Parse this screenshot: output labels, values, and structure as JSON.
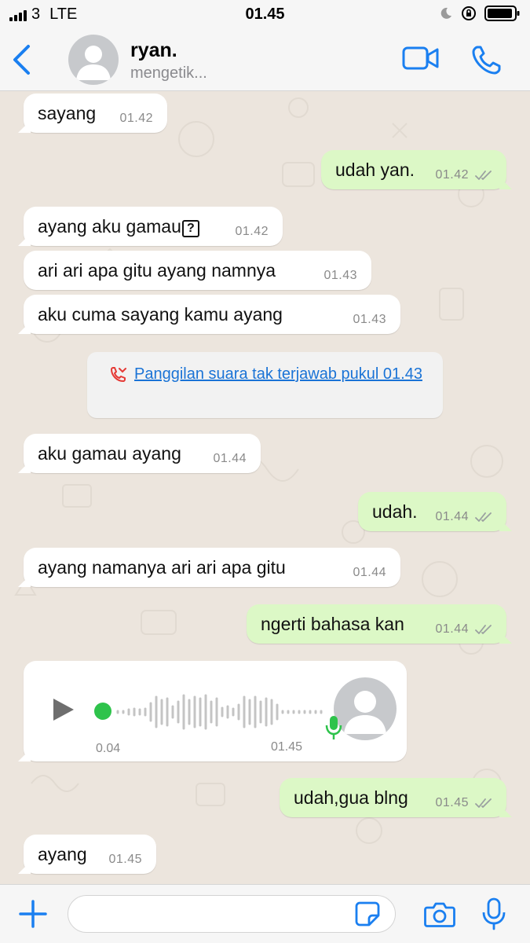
{
  "status_bar": {
    "carrier": "3",
    "network": "LTE",
    "time": "01.45"
  },
  "header": {
    "contact_name": "ryan.",
    "contact_status": "mengetik..."
  },
  "messages": [
    {
      "dir": "in",
      "text": "sayang",
      "time": "01.42"
    },
    {
      "dir": "out",
      "text": "udah yan.",
      "time": "01.42"
    },
    {
      "dir": "in",
      "text": "ayang aku gamau",
      "time": "01.42"
    },
    {
      "dir": "in",
      "text": "ari ari apa gitu ayang namnya",
      "time": "01.43"
    },
    {
      "dir": "in",
      "text": "aku cuma sayang kamu ayang",
      "time": "01.43"
    },
    {
      "dir": "in",
      "text": "aku gamau ayang",
      "time": "01.44"
    },
    {
      "dir": "out",
      "text": "udah.",
      "time": "01.44"
    },
    {
      "dir": "in",
      "text": "ayang namanya ari ari apa gitu",
      "time": "01.44"
    },
    {
      "dir": "out",
      "text": "ngerti bahasa kan",
      "time": "01.44"
    },
    {
      "dir": "out",
      "text": "udah,gua blng",
      "time": "01.45"
    },
    {
      "dir": "in",
      "text": "ayang",
      "time": "01.45"
    }
  ],
  "missed_call": {
    "text": "Panggilan suara tak terjawab pukul 01.43"
  },
  "voice_note": {
    "duration": "0.04",
    "time": "01.45"
  },
  "colors": {
    "accent": "#1a7ff0",
    "outgoing_bubble": "#dcf8c6",
    "incoming_bubble": "#ffffff",
    "chat_bg": "#ece5dd",
    "voice_dot": "#2ec34b"
  }
}
